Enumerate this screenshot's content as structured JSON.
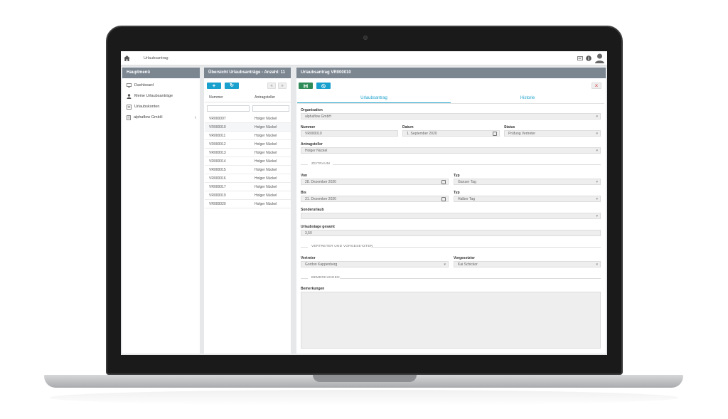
{
  "topbar": {
    "title": "Urlaubsantrag",
    "icons": [
      "home-icon",
      "message-icon",
      "info-icon",
      "user-icon"
    ]
  },
  "sidebar": {
    "header": "Hauptmenü",
    "items": [
      {
        "label": "Dashboard",
        "icon": "dashboard-icon"
      },
      {
        "label": "Meine Urlaubsanträge",
        "icon": "person-icon"
      },
      {
        "label": "Urlaubskonten",
        "icon": "account-icon"
      },
      {
        "label": "alphaflow GmbH",
        "icon": "building-icon",
        "chevron": "‹"
      }
    ]
  },
  "list": {
    "header": "Übersicht Urlaubsanträge - Anzahl: 11",
    "add_label": "+",
    "refresh_label": "↻",
    "prev_label": "«",
    "next_label": "»",
    "columns": [
      "Nummer",
      "Antragsteller"
    ],
    "rows": [
      {
        "nummer": "VR000007",
        "antragsteller": "Holger Nückel"
      },
      {
        "nummer": "VR000010",
        "antragsteller": "Holger Nückel"
      },
      {
        "nummer": "VR000011",
        "antragsteller": "Holger Nückel"
      },
      {
        "nummer": "VR000012",
        "antragsteller": "Holger Nückel"
      },
      {
        "nummer": "VR000013",
        "antragsteller": "Holger Nückel"
      },
      {
        "nummer": "VR000014",
        "antragsteller": "Holger Nückel"
      },
      {
        "nummer": "VR000015",
        "antragsteller": "Holger Nückel"
      },
      {
        "nummer": "VR000016",
        "antragsteller": "Holger Nückel"
      },
      {
        "nummer": "VR000017",
        "antragsteller": "Holger Nückel"
      },
      {
        "nummer": "VR000019",
        "antragsteller": "Holger Nückel"
      },
      {
        "nummer": "VR000020",
        "antragsteller": "Holger Nückel"
      }
    ]
  },
  "detail": {
    "header": "Urlaubsantrag VR000010",
    "close_label": "×",
    "tabs": [
      "Urlaubsantrag",
      "Historie"
    ],
    "labels": {
      "organisation": "Organisation",
      "nummer": "Nummer",
      "datum": "Datum",
      "status": "Status",
      "antragsteller": "Antragsteller",
      "von": "Von",
      "typ": "Typ",
      "bis": "Bis",
      "sonderurlaub": "Sonderurlaub",
      "urlaubstage": "Urlaubstage gesamt",
      "vertreter": "Vertreter",
      "vorgesetzter": "Vorgesetzter",
      "bemerkungen": "Bemerkungen"
    },
    "values": {
      "organisation": "alphaflow GmbH",
      "nummer": "VR000010",
      "datum": "1. September 2020",
      "status": "Prüfung Vertreter",
      "antragsteller": "Holger Nückel",
      "von": "28. Dezember 2020",
      "typ_von": "Ganzer Tag",
      "bis": "31. Dezember 2020",
      "typ_bis": "Halber Tag",
      "sonderurlaub": "",
      "urlaubstage": "3,50",
      "vertreter": "Gordon Kappenberg",
      "vorgesetzter": "Kai Schickor"
    },
    "sections": {
      "zeitraum": "ZEITRAUM",
      "vertreter": "VERTRETER UND VORGESETZTER",
      "bemerkungen": "BEMERKUNGEN"
    },
    "dropdown_arrow": "▾"
  },
  "colors": {
    "header": "#7b8691",
    "accent": "#1aa0cc",
    "save": "#2e8b57",
    "close": "#d33c3c"
  }
}
